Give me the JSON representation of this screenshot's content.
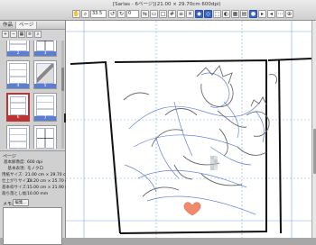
{
  "document": {
    "title": "[Sarlas - 6ページ](21.00 × 29.70cm 600dpi)"
  },
  "toolbar": {
    "zoom": "33.5",
    "angle": "0"
  },
  "panel": {
    "tabs": [
      "作品",
      "ページ"
    ],
    "spreads": [
      {
        "pages": [
          {
            "num": "2",
            "style": "b1"
          },
          {
            "num": "3",
            "style": "grid"
          }
        ]
      },
      {
        "pages": [
          {
            "num": "4",
            "style": "b1"
          },
          {
            "num": "5",
            "style": "dark"
          }
        ]
      },
      {
        "pages": [
          {
            "num": "6",
            "style": "b1",
            "selected": true
          },
          {
            "num": "7",
            "style": "b1"
          }
        ]
      },
      {
        "pages": [
          {
            "num": "8",
            "style": "b1"
          },
          {
            "num": "9",
            "style": "grid"
          }
        ]
      }
    ]
  },
  "properties": {
    "title": "ページ",
    "rows": [
      {
        "k": "基本解像度:",
        "v": "600 dpi"
      },
      {
        "k": "基本表現:",
        "v": "モノクロ"
      },
      {
        "k": "用紙サイズ:",
        "v": "21.00 cm × 29.70 cm"
      },
      {
        "k": "仕上がりサイズ:",
        "v": "18.20 cm × 25.70 cm"
      },
      {
        "k": "基本枠サイズ:",
        "v": "15.00 cm × 21.90 cm"
      },
      {
        "k": "裁ち落とし幅:",
        "v": "10.00 mm"
      }
    ],
    "memo_label": "メモ:",
    "edit_label": "編集..."
  }
}
